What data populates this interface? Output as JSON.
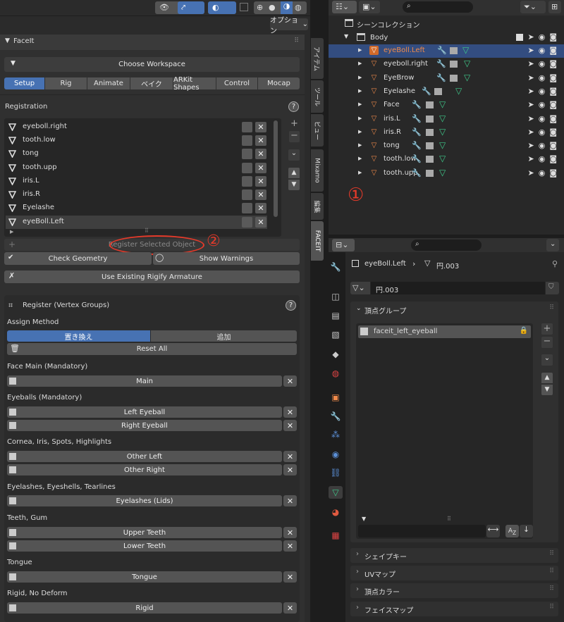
{
  "viewport_header": {
    "mode": "オプション"
  },
  "panel": {
    "title": "FaceIt",
    "workspace": "Choose Workspace"
  },
  "tabs": [
    "Setup",
    "Rig",
    "Animate",
    "ベイク",
    "ARKit Shapes",
    "Control",
    "Mocap"
  ],
  "registration": {
    "title": "Registration",
    "items": [
      "eyeboll.right",
      "tooth.low",
      "tong",
      "tooth.upp",
      "iris.L",
      "iris.R",
      "Eyelashe",
      "eyeBoll.Left"
    ],
    "register_btn": "Register Selected Object",
    "annotation": "②",
    "check": "Check Geometry",
    "warnings": "Show Warnings",
    "armature": "Use Existing Rigify Armature"
  },
  "vgroups": {
    "title": "Register (Vertex Groups)",
    "assign": "Assign Method",
    "replace": "置き換え",
    "add": "追加",
    "reset": "Reset All",
    "sections": [
      {
        "label": "Face Main (Mandatory)",
        "rows": [
          "Main"
        ]
      },
      {
        "label": "Eyeballs (Mandatory)",
        "rows": [
          "Left Eyeball",
          "Right Eyeball"
        ]
      },
      {
        "label": "Cornea, Iris, Spots, Highlights",
        "rows": [
          "Other Left",
          "Other Right"
        ]
      },
      {
        "label": "Eyelashes, Eyeshells, Tearlines",
        "rows": [
          "Eyelashes (Lids)"
        ]
      },
      {
        "label": "Teeth, Gum",
        "rows": [
          "Upper Teeth",
          "Lower Teeth"
        ]
      },
      {
        "label": "Tongue",
        "rows": [
          "Tongue"
        ]
      },
      {
        "label": "Rigid, No Deform",
        "rows": [
          "Rigid"
        ]
      }
    ]
  },
  "side_tabs": [
    "アイテム",
    "ツール",
    "ビュー",
    "Mixamo",
    "編集",
    "FACEIT"
  ],
  "outliner": {
    "collection": "シーンコレクション",
    "parent": "Body",
    "items": [
      "eyeBoll.Left",
      "eyeboll.right",
      "EyeBrow",
      "Eyelashe",
      "Face",
      "iris.L",
      "iris.R",
      "tong",
      "tooth.low",
      "tooth.upp"
    ],
    "annotation": "①"
  },
  "properties": {
    "object": "eyeBoll.Left",
    "data": "円.003",
    "mesh_field": "円.003",
    "vg_panel": "頂点グループ",
    "vg_item": "faceit_left_eyeball",
    "panels": [
      "シェイプキー",
      "UVマップ",
      "頂点カラー",
      "フェイスマップ"
    ]
  },
  "colors": {
    "accent": "#4772b3",
    "active_row": "#334d80",
    "orange": "#e8804a",
    "red": "#e53a2a",
    "green": "#3fc98a",
    "blue": "#5b8fd6"
  }
}
